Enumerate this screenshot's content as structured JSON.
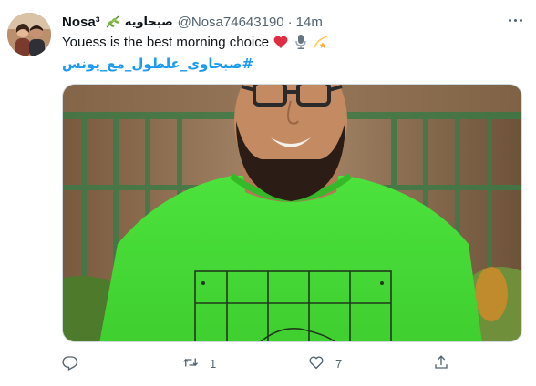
{
  "user": {
    "display_name": "Nosa³",
    "display_name_icon": "leaf-icon",
    "arabic_name": "صبحاويه",
    "handle": "@Nosa74643190",
    "separator": "·",
    "timestamp": "14m"
  },
  "tweet": {
    "text": "Youess is the best morning choice",
    "emojis": [
      "red-heart-icon",
      "microphone-icon",
      "dizzy-star-icon"
    ],
    "hashtag": "#صبحاوى_علطول_مع_يونس"
  },
  "media": {
    "description_icon": "photo-man-green-shirt"
  },
  "actions": {
    "reply_count": "",
    "retweet_count": "1",
    "like_count": "7",
    "share_count": ""
  },
  "colors": {
    "text": "#0f1419",
    "secondary": "#536471",
    "link": "#1d9bf0",
    "heart": "#e0245e",
    "shirt": "#4ddc3a"
  }
}
